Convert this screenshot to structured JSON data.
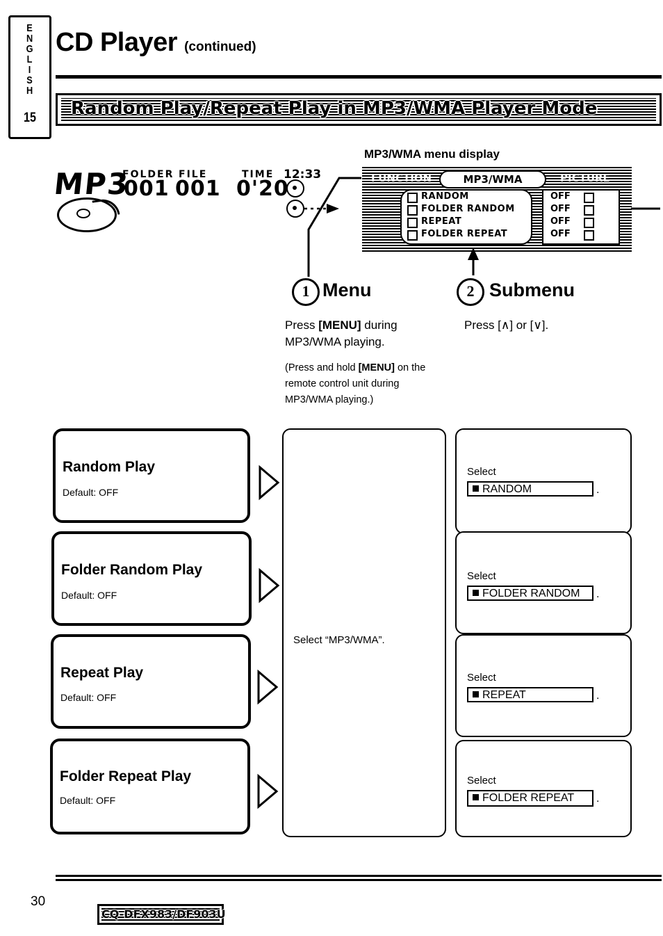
{
  "sidebar": {
    "language": "ENGLISH",
    "page_number": "15"
  },
  "header": {
    "title": "CD Player",
    "continued": "(continued)",
    "banner": "Random Play/Repeat Play in MP3/WMA Player Mode"
  },
  "display_example": {
    "caption": "MP3/WMA menu display",
    "mp3_logo": "MP3",
    "folder_label": "FOLDER",
    "folder_value": "001",
    "file_label": "FILE",
    "file_value": "001",
    "time_label": "TIME",
    "time_value": "0'20",
    "clock": "12:33",
    "tab_function": "FUNCTION",
    "tab_mp3wma": "MP3/WMA",
    "tab_picture": "PICTURE",
    "menu_items": [
      "RANDOM",
      "FOLDER RANDOM",
      "REPEAT",
      "FOLDER REPEAT"
    ],
    "off_items": [
      "OFF",
      "OFF",
      "OFF",
      "OFF"
    ]
  },
  "steps": [
    {
      "num": "1",
      "heading": "Menu",
      "line1_pre": "Press ",
      "line1_key": "[MENU]",
      "line1_post": " during",
      "line2": "MP3/WMA playing.",
      "note_pre": "(Press and hold ",
      "note_key": "[MENU]",
      "note_post": " on the",
      "note2": "remote  control  unit  during",
      "note3": "MP3/WMA playing.)"
    },
    {
      "num": "2",
      "heading": "Submenu",
      "line1": "Press [∧] or [∨]."
    }
  ],
  "rows": [
    {
      "title": "Random Play",
      "default": "Default: OFF",
      "select_label": "Select",
      "select_value": "RANDOM"
    },
    {
      "title": "Folder Random Play",
      "default": "Default: OFF",
      "select_label": "Select",
      "select_value": "FOLDER RANDOM"
    },
    {
      "title": "Repeat Play",
      "default": "Default: OFF",
      "select_label": "Select",
      "select_value": "REPEAT"
    },
    {
      "title": "Folder Repeat Play",
      "default": "Default: OFF",
      "select_label": "Select",
      "select_value": "FOLDER REPEAT"
    }
  ],
  "middle": {
    "text": "Select “MP3/WMA”."
  },
  "footer": {
    "page": "30",
    "model": "CQ-DFX983/DF903U"
  }
}
